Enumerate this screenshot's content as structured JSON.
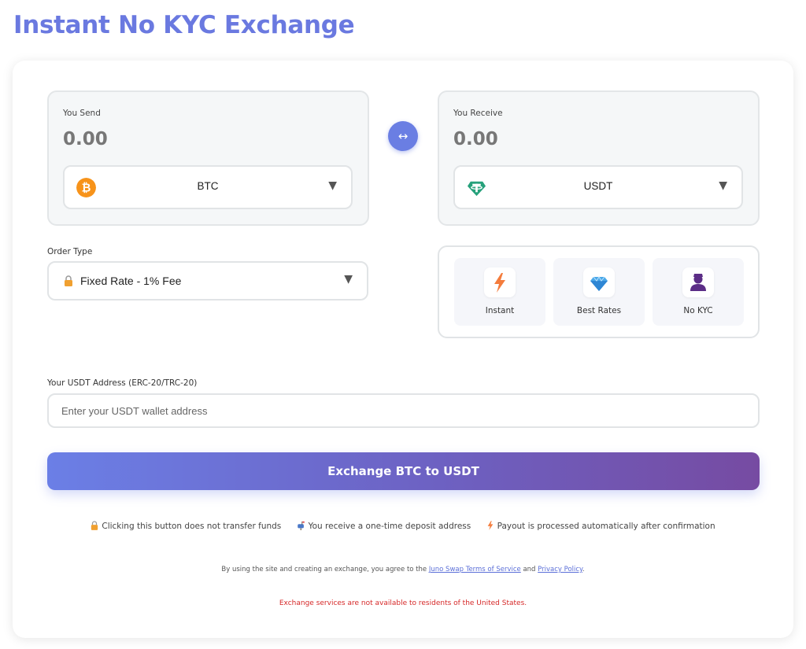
{
  "page_title": "Instant No KYC Exchange",
  "send": {
    "label": "You Send",
    "amount": "0.00",
    "currency": "BTC",
    "icon": "bitcoin-icon",
    "icon_color": "#f7931a"
  },
  "receive": {
    "label": "You Receive",
    "amount": "0.00",
    "currency": "USDT",
    "icon": "tether-icon",
    "icon_color": "#26a17b"
  },
  "swap_symbol": "↔",
  "order_type": {
    "label": "Order Type",
    "value": "Fixed Rate - 1% Fee"
  },
  "features": [
    {
      "label": "Instant",
      "icon": "lightning-icon"
    },
    {
      "label": "Best Rates",
      "icon": "diamond-icon"
    },
    {
      "label": "No KYC",
      "icon": "incognito-user-icon"
    }
  ],
  "address": {
    "label": "Your USDT Address (ERC-20/TRC-20)",
    "placeholder": "Enter your USDT wallet address",
    "value": ""
  },
  "exchange_button": "Exchange BTC to USDT",
  "notes": [
    "Clicking this button does not transfer funds",
    "You receive a one-time deposit address",
    "Payout is processed automatically after confirmation"
  ],
  "terms": {
    "prefix": "By using the site and creating an exchange, you agree to the",
    "tos_link": "Juno Swap Terms of Service",
    "and": "and",
    "privacy_link": "Privacy Policy",
    "suffix": "."
  },
  "warning": "Exchange services are not available to residents of the United States.",
  "colors": {
    "accent": "#6a79e0",
    "button_start": "#6b7fe6",
    "button_end": "#764ba2",
    "warning": "#d62828"
  }
}
